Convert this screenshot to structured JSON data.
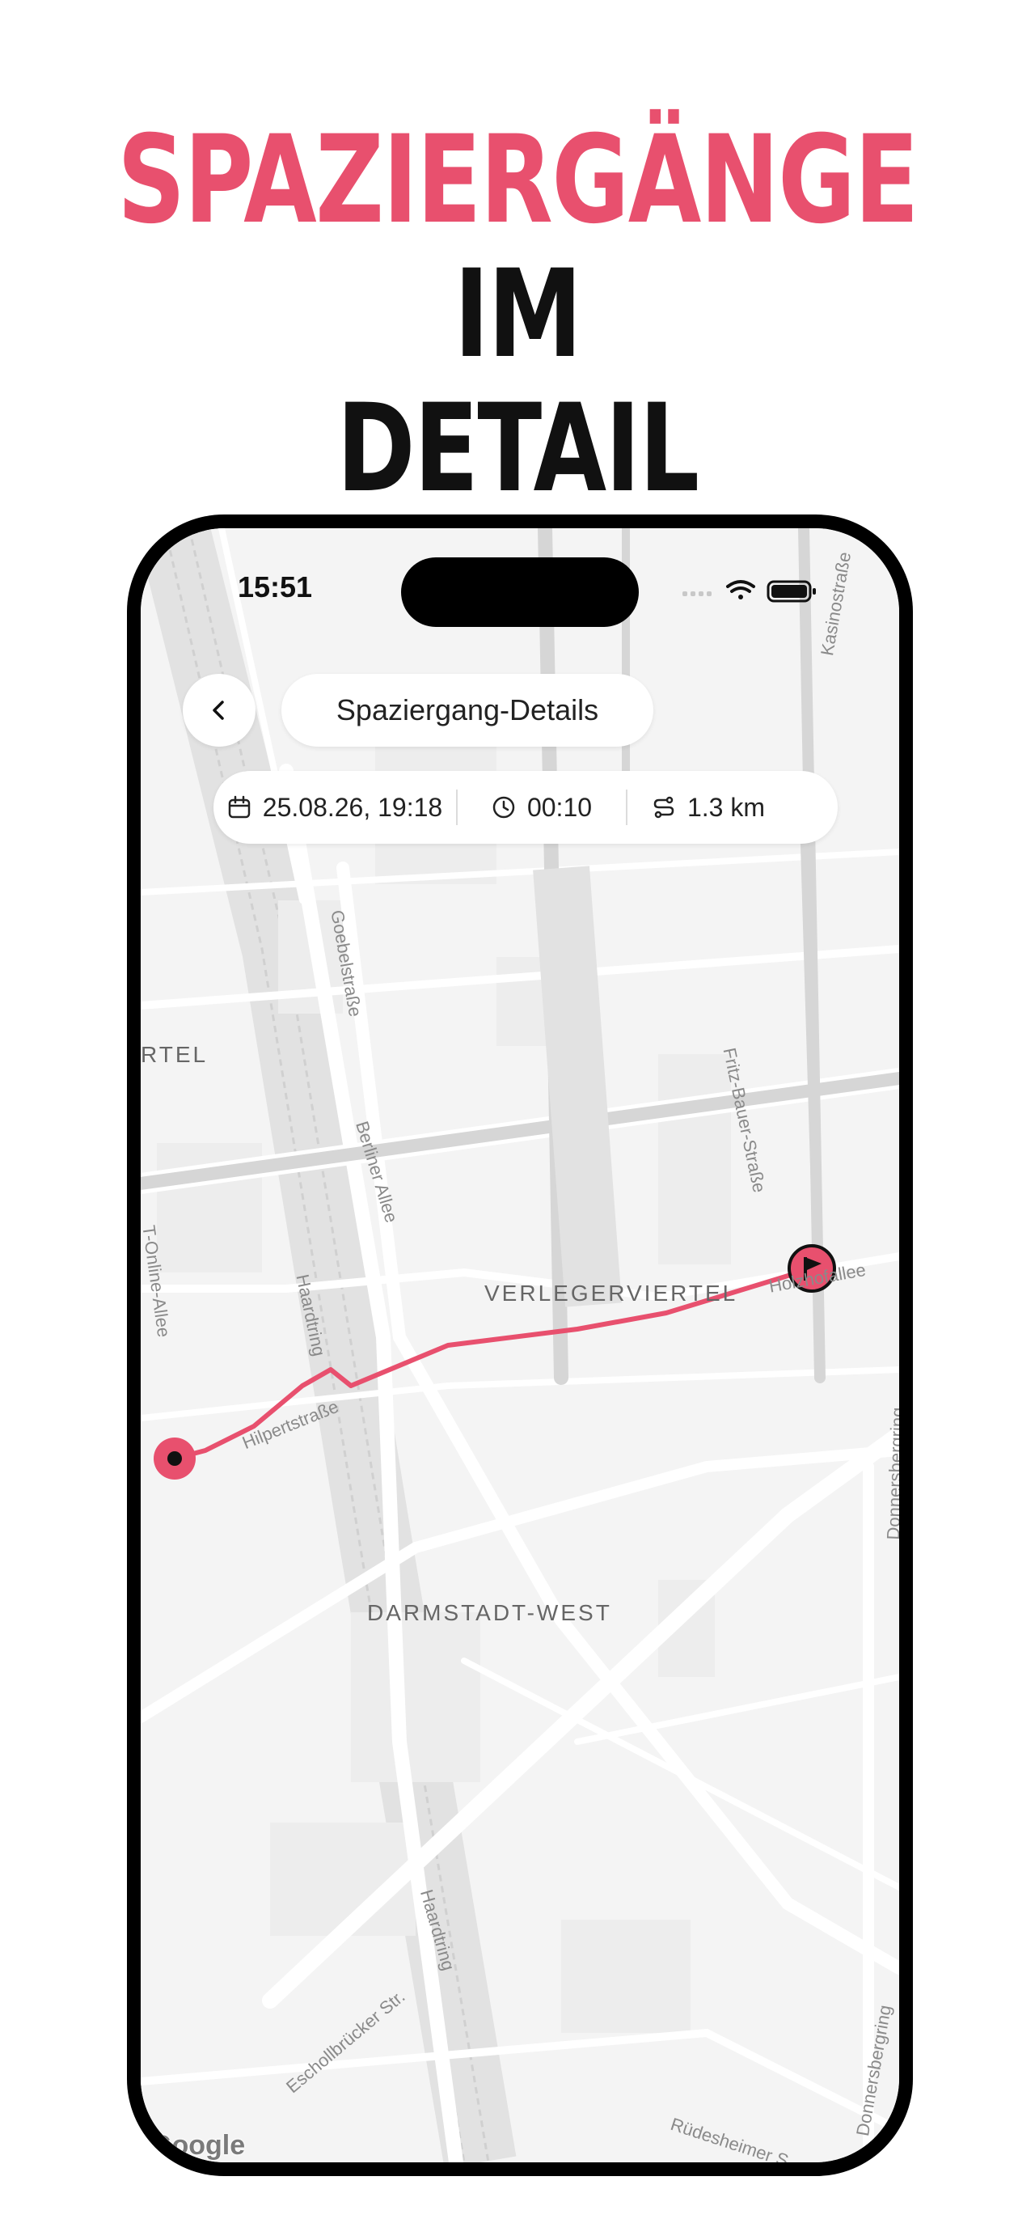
{
  "headline": {
    "word_pink": "SPAZIERGÄNGE",
    "word_dark_1": "IM",
    "word_dark_2": "DETAIL"
  },
  "status_bar": {
    "time": "15:51"
  },
  "header": {
    "title": "Spaziergang-Details",
    "back_icon": "chevron-left-icon"
  },
  "walk_info": {
    "date": "25.08.26, 19:18",
    "duration": "00:10",
    "distance": "1.3 km"
  },
  "map": {
    "districts": [
      "VERLEGERVIERTEL",
      "DARMSTADT-WEST",
      "RTEL"
    ],
    "streets": {
      "goebelstrasse": "Goebelstraße",
      "berliner_allee": "Berliner Allee",
      "fritz_bauer": "Fritz-Bauer-Straße",
      "haardtring_1": "Haardtring",
      "haardtring_2": "Haardtring",
      "holzhofallee": "Holzhofallee",
      "hilpertstrasse": "Hilpertstraße",
      "t_online_allee": "T-Online-Allee",
      "kasinostrasse": "Kasinostraße",
      "eschollbruecker": "Eschollbrücker Str.",
      "donnersbergring_1": "Donnersbergring",
      "donnersbergring_2": "Donnersbergring",
      "ruedesheimer": "Rüdesheimer S"
    },
    "attribution": "Google",
    "route_color": "#e8506e",
    "start_marker_icon": "start-dot-icon",
    "end_marker_icon": "finish-flag-icon"
  },
  "colors": {
    "accent": "#e8506e",
    "text_dark": "#111111",
    "map_bg": "#f4f4f4"
  }
}
